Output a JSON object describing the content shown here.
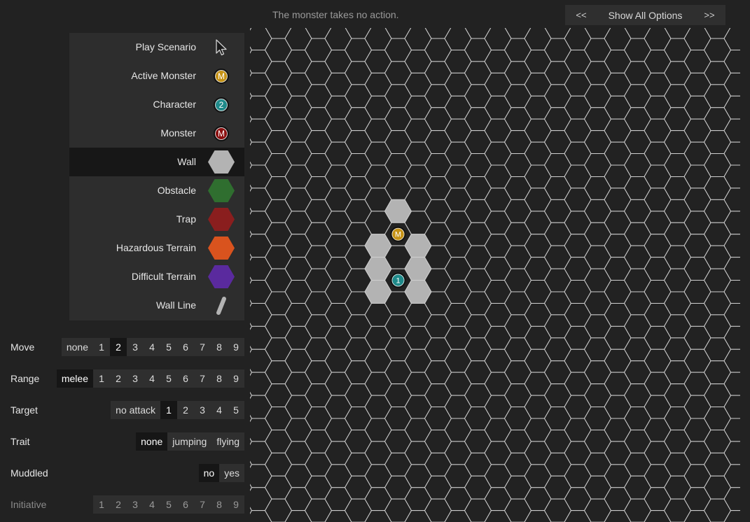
{
  "status_text": "The monster takes no action.",
  "top_nav": {
    "prev": "<<",
    "show_all": "Show All Options",
    "next": ">>"
  },
  "palette": [
    {
      "label": "Play Scenario",
      "icon": "cursor-icon"
    },
    {
      "label": "Active Monster",
      "icon": "active-monster-icon",
      "token": "M",
      "color": "#c69214"
    },
    {
      "label": "Character",
      "icon": "character-icon",
      "token": "2",
      "color": "#1f8a8a"
    },
    {
      "label": "Monster",
      "icon": "monster-icon",
      "token": "M",
      "color": "#8b0f0f"
    },
    {
      "label": "Wall",
      "icon": "wall-hex-icon",
      "color": "#b3b3b3",
      "selected": true
    },
    {
      "label": "Obstacle",
      "icon": "obstacle-hex-icon",
      "color": "#2f6e2f"
    },
    {
      "label": "Trap",
      "icon": "trap-hex-icon",
      "color": "#8a1e1e"
    },
    {
      "label": "Hazardous Terrain",
      "icon": "hazard-hex-icon",
      "color": "#d9531e"
    },
    {
      "label": "Difficult Terrain",
      "icon": "difficult-hex-icon",
      "color": "#5a2a9e"
    },
    {
      "label": "Wall Line",
      "icon": "wall-line-icon",
      "color": "#b3b3b3"
    }
  ],
  "controls": [
    {
      "label": "Move",
      "options": [
        "none",
        "1",
        "2",
        "3",
        "4",
        "5",
        "6",
        "7",
        "8",
        "9"
      ],
      "selected": "2"
    },
    {
      "label": "Range",
      "options": [
        "melee",
        "1",
        "2",
        "3",
        "4",
        "5",
        "6",
        "7",
        "8",
        "9"
      ],
      "selected": "melee"
    },
    {
      "label": "Target",
      "options": [
        "no attack",
        "1",
        "2",
        "3",
        "4",
        "5"
      ],
      "selected": "1"
    },
    {
      "label": "Trait",
      "options": [
        "none",
        "jumping",
        "flying"
      ],
      "selected": "none"
    },
    {
      "label": "Muddled",
      "options": [
        "no",
        "yes"
      ],
      "selected": "no"
    },
    {
      "label": "Initiative",
      "options": [
        "1",
        "2",
        "3",
        "4",
        "5",
        "6",
        "7",
        "8",
        "9"
      ],
      "selected": null,
      "disabled": true
    }
  ],
  "board": {
    "walls": [
      [
        8,
        8
      ],
      [
        7,
        9
      ],
      [
        9,
        9
      ],
      [
        7,
        10
      ],
      [
        9,
        10
      ],
      [
        7,
        11
      ],
      [
        9,
        11
      ]
    ],
    "active_monster": {
      "cell": [
        8,
        9
      ],
      "label": "M",
      "color": "#c69214"
    },
    "character": {
      "cell": [
        8,
        11
      ],
      "label": "1",
      "color": "#1f8a8a"
    },
    "wall_color": "#b3b3b3",
    "grid_color": "#cfcfcf"
  }
}
